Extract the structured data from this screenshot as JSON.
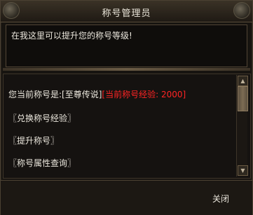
{
  "dialog": {
    "title": "称号管理员"
  },
  "message": {
    "text": "在我这里可以提升您的称号等级!"
  },
  "options": {
    "current_prefix": "您当前称号是:[至尊传说]",
    "current_exp": "[当前称号经验: 2000]",
    "items": [
      "〖兑换称号经验〗",
      "〖提升称号〗",
      "〖称号属性查询〗"
    ]
  },
  "footer": {
    "close_label": "关闭"
  },
  "colors": {
    "highlight": "#ff2424",
    "text": "#ebe7dd"
  },
  "icons": {
    "scroll_up": "scroll-up-arrow-icon",
    "scroll_down": "scroll-down-arrow-icon"
  }
}
